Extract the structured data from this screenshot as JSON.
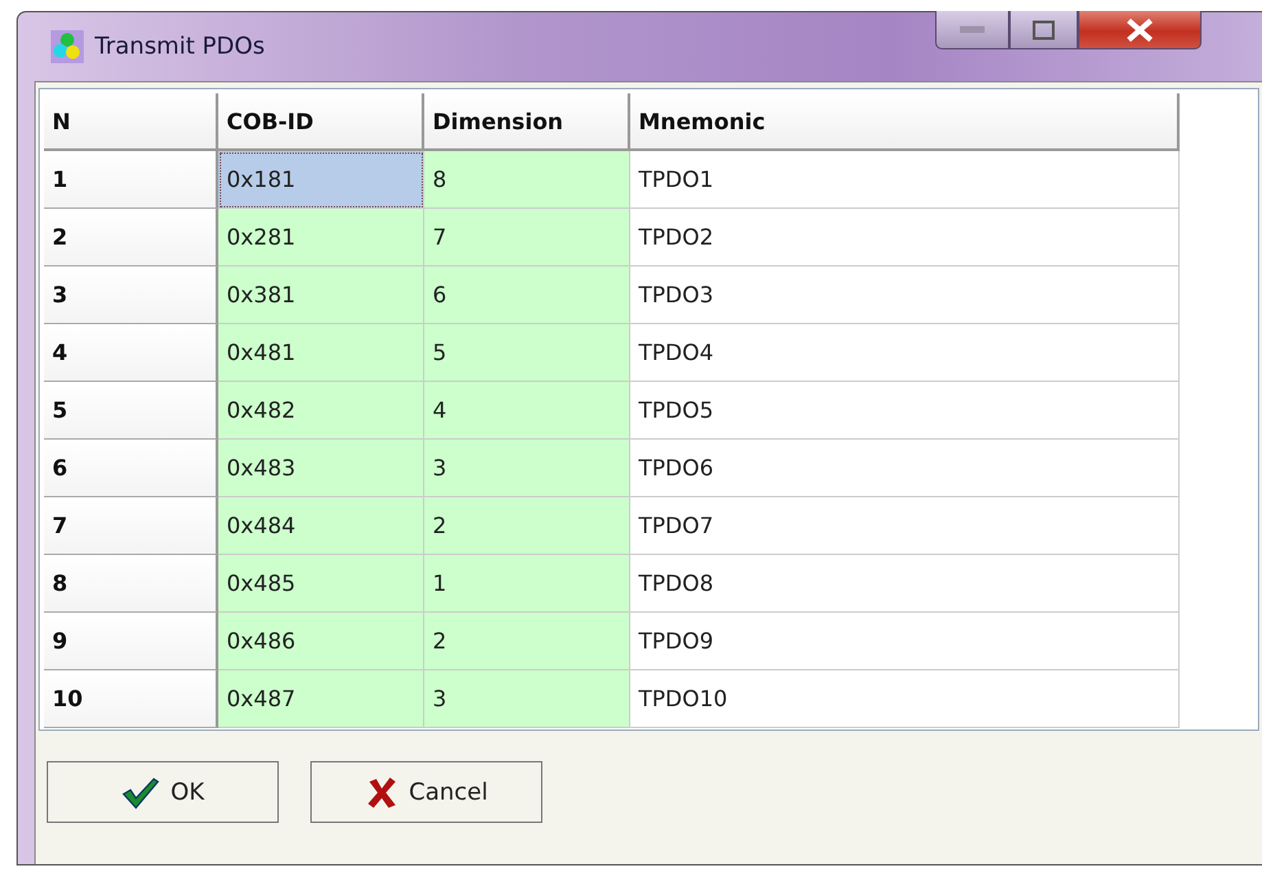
{
  "window": {
    "title": "Transmit PDOs"
  },
  "table": {
    "columns": [
      "N",
      "COB-ID",
      "Dimension",
      "Mnemonic"
    ],
    "rows": [
      {
        "n": "1",
        "cob_id": "0x181",
        "dimension": "8",
        "mnemonic": "TPDO1",
        "selected": true
      },
      {
        "n": "2",
        "cob_id": "0x281",
        "dimension": "7",
        "mnemonic": "TPDO2",
        "selected": false
      },
      {
        "n": "3",
        "cob_id": "0x381",
        "dimension": "6",
        "mnemonic": "TPDO3",
        "selected": false
      },
      {
        "n": "4",
        "cob_id": "0x481",
        "dimension": "5",
        "mnemonic": "TPDO4",
        "selected": false
      },
      {
        "n": "5",
        "cob_id": "0x482",
        "dimension": "4",
        "mnemonic": "TPDO5",
        "selected": false
      },
      {
        "n": "6",
        "cob_id": "0x483",
        "dimension": "3",
        "mnemonic": "TPDO6",
        "selected": false
      },
      {
        "n": "7",
        "cob_id": "0x484",
        "dimension": "2",
        "mnemonic": "TPDO7",
        "selected": false
      },
      {
        "n": "8",
        "cob_id": "0x485",
        "dimension": "1",
        "mnemonic": "TPDO8",
        "selected": false
      },
      {
        "n": "9",
        "cob_id": "0x486",
        "dimension": "2",
        "mnemonic": "TPDO9",
        "selected": false
      },
      {
        "n": "10",
        "cob_id": "0x487",
        "dimension": "3",
        "mnemonic": "TPDO10",
        "selected": false
      }
    ]
  },
  "buttons": [
    {
      "kind": "ok",
      "label": "OK"
    },
    {
      "kind": "cancel",
      "label": "Cancel"
    }
  ]
}
